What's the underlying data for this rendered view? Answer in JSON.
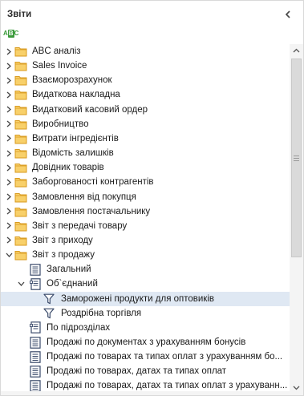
{
  "panel": {
    "title": "Звіти",
    "sort_icon_text": [
      "A",
      "B",
      "C"
    ]
  },
  "tree": [
    {
      "label": "ABC аналіз",
      "icon": "folder-icon",
      "level": 0,
      "expander": "collapsed"
    },
    {
      "label": "Sales Invoice",
      "icon": "folder-icon",
      "level": 0,
      "expander": "collapsed"
    },
    {
      "label": "Взаєморозрахунок",
      "icon": "folder-icon",
      "level": 0,
      "expander": "collapsed"
    },
    {
      "label": "Видаткова накладна",
      "icon": "folder-icon",
      "level": 0,
      "expander": "collapsed"
    },
    {
      "label": "Видатковий касовий ордер",
      "icon": "folder-icon",
      "level": 0,
      "expander": "collapsed"
    },
    {
      "label": "Виробництво",
      "icon": "folder-icon",
      "level": 0,
      "expander": "collapsed"
    },
    {
      "label": "Витрати інгредієнтів",
      "icon": "folder-icon",
      "level": 0,
      "expander": "collapsed"
    },
    {
      "label": "Відомість залишків",
      "icon": "folder-icon",
      "level": 0,
      "expander": "collapsed"
    },
    {
      "label": "Довідник товарів",
      "icon": "folder-icon",
      "level": 0,
      "expander": "collapsed"
    },
    {
      "label": "Заборгованості контрагентів",
      "icon": "folder-icon",
      "level": 0,
      "expander": "collapsed"
    },
    {
      "label": "Замовлення від покупця",
      "icon": "folder-icon",
      "level": 0,
      "expander": "collapsed"
    },
    {
      "label": "Замовлення постачальнику",
      "icon": "folder-icon",
      "level": 0,
      "expander": "collapsed"
    },
    {
      "label": "Звіт з передачі товару",
      "icon": "folder-icon",
      "level": 0,
      "expander": "collapsed"
    },
    {
      "label": "Звіт з приходу",
      "icon": "folder-icon",
      "level": 0,
      "expander": "collapsed"
    },
    {
      "label": "Звіт з продажу",
      "icon": "folder-icon",
      "level": 0,
      "expander": "expanded"
    },
    {
      "label": "Загальний",
      "icon": "report-icon",
      "level": 1,
      "expander": "none"
    },
    {
      "label": "Об`єднаний",
      "icon": "report-group-icon",
      "level": 1,
      "expander": "expanded"
    },
    {
      "label": "Заморожені продукти для оптовиків",
      "icon": "filter-icon",
      "level": 2,
      "expander": "none",
      "selected": true
    },
    {
      "label": "Роздрібна торгівля",
      "icon": "filter-icon",
      "level": 2,
      "expander": "none"
    },
    {
      "label": "По підрозділах",
      "icon": "report-group-icon",
      "level": 1,
      "expander": "none"
    },
    {
      "label": "Продажі по документах з урахуванням бонусів",
      "icon": "report-icon",
      "level": 1,
      "expander": "none"
    },
    {
      "label": "Продажі по товарах та типах оплат з урахуванням бо...",
      "icon": "report-icon",
      "level": 1,
      "expander": "none"
    },
    {
      "label": "Продажі по товарах, датах та типах оплат",
      "icon": "report-icon",
      "level": 1,
      "expander": "none"
    },
    {
      "label": "Продажі по товарах, датах та типах оплат з урахуванн...",
      "icon": "report-icon",
      "level": 1,
      "expander": "none"
    }
  ],
  "colors": {
    "folder_fill": "#f8d06a",
    "folder_stroke": "#d99a1e",
    "selection": "#dfe8f3",
    "sort_green": "#3a9a3a"
  },
  "icons": {
    "collapse_panel": "chevron-left-icon",
    "scroll_up": "arrow-up-icon",
    "scroll_down": "arrow-down-icon",
    "scroll_grip": "grip-icon"
  }
}
